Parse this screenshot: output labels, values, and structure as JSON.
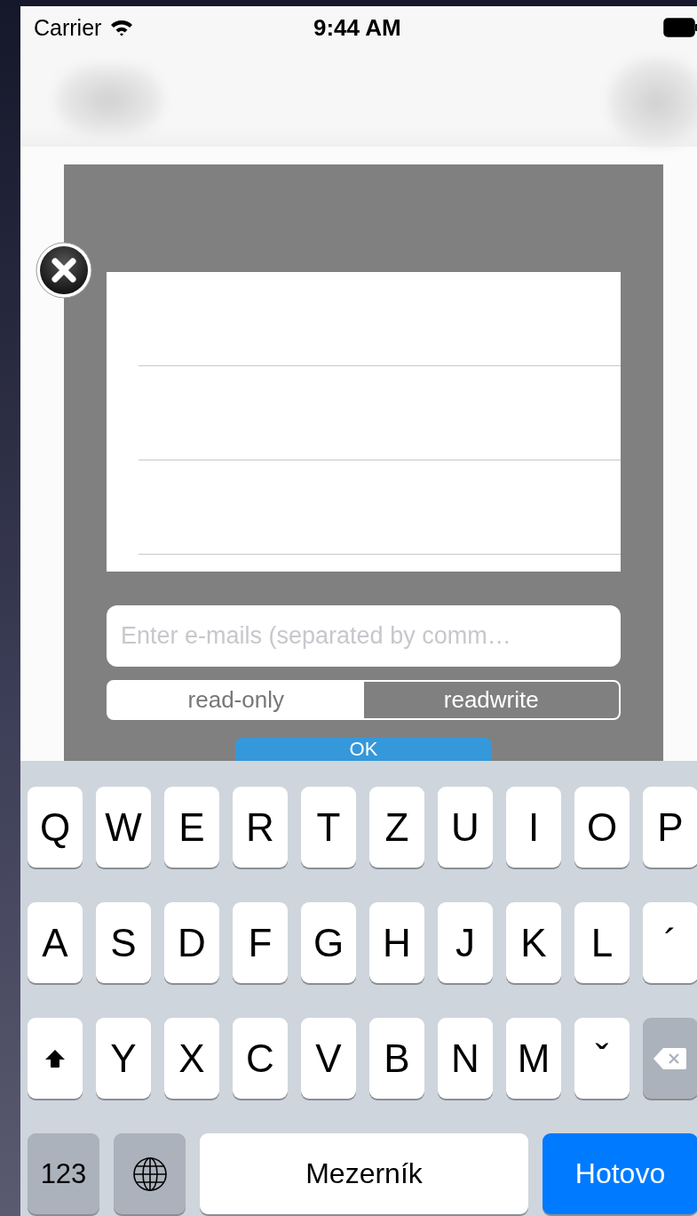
{
  "status_bar": {
    "carrier": "Carrier",
    "time": "9:44 AM"
  },
  "dialog": {
    "email_field": {
      "placeholder": "Enter e-mails (separated by comm…"
    },
    "access": [
      {
        "label": "read-only",
        "selected": false
      },
      {
        "label": "readwrite",
        "selected": true
      }
    ],
    "ok_button": "OK"
  },
  "keyboard": {
    "letter_rows": [
      [
        {
          "kind": "char",
          "label": "Q"
        },
        {
          "kind": "char",
          "label": "W"
        },
        {
          "kind": "char",
          "label": "E"
        },
        {
          "kind": "char",
          "label": "R"
        },
        {
          "kind": "char",
          "label": "T"
        },
        {
          "kind": "char",
          "label": "Z"
        },
        {
          "kind": "char",
          "label": "U"
        },
        {
          "kind": "char",
          "label": "I"
        },
        {
          "kind": "char",
          "label": "O"
        },
        {
          "kind": "char",
          "label": "P"
        }
      ],
      [
        {
          "kind": "char",
          "label": "A"
        },
        {
          "kind": "char",
          "label": "S"
        },
        {
          "kind": "char",
          "label": "D"
        },
        {
          "kind": "char",
          "label": "F"
        },
        {
          "kind": "char",
          "label": "G"
        },
        {
          "kind": "char",
          "label": "H"
        },
        {
          "kind": "char",
          "label": "J"
        },
        {
          "kind": "char",
          "label": "K"
        },
        {
          "kind": "char",
          "label": "L"
        },
        {
          "kind": "char",
          "label": "´"
        }
      ],
      [
        {
          "kind": "shift"
        },
        {
          "kind": "char",
          "label": "Y"
        },
        {
          "kind": "char",
          "label": "X"
        },
        {
          "kind": "char",
          "label": "C"
        },
        {
          "kind": "char",
          "label": "V"
        },
        {
          "kind": "char",
          "label": "B"
        },
        {
          "kind": "char",
          "label": "N"
        },
        {
          "kind": "char",
          "label": "M"
        },
        {
          "kind": "char",
          "label": "ˇ"
        },
        {
          "kind": "backspace"
        }
      ]
    ],
    "bottom_keys": [
      {
        "kind": "mode",
        "label": "123"
      },
      {
        "kind": "globe"
      },
      {
        "kind": "space",
        "label": "Mezerník"
      },
      {
        "kind": "done",
        "label": "Hotovo"
      }
    ]
  }
}
